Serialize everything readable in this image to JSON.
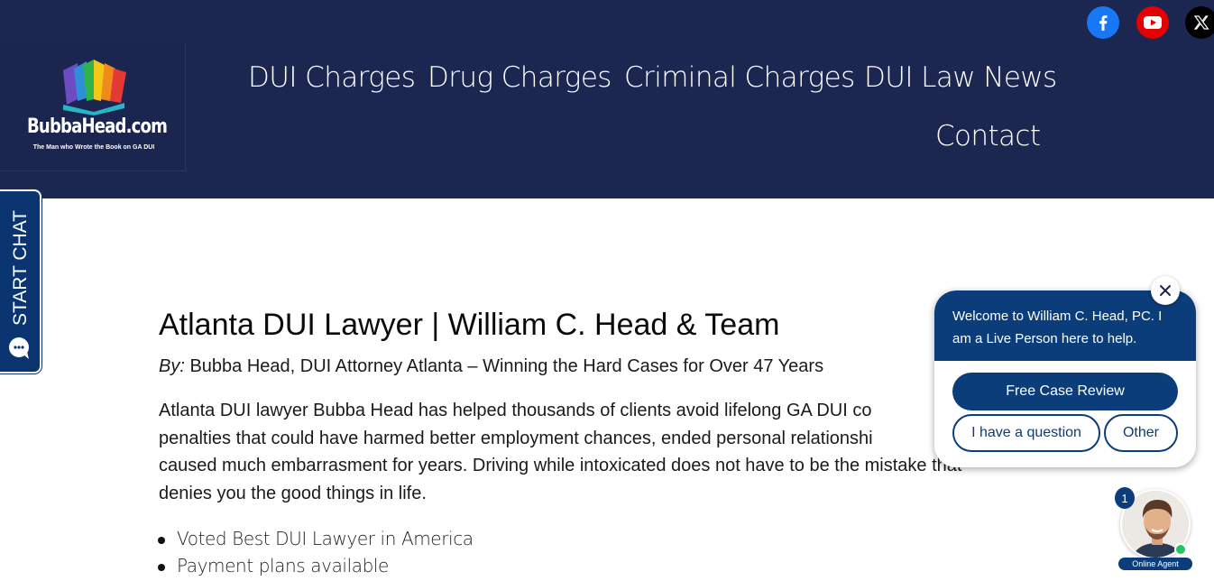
{
  "header": {
    "logo": {
      "name": "BubbaHead.com",
      "tagline": "The Man who Wrote the Book on GA DUI"
    },
    "nav": [
      {
        "label": "DUI Charges"
      },
      {
        "label": "Drug Charges"
      },
      {
        "label": "Criminal Charges"
      },
      {
        "label": "DUI Law News"
      },
      {
        "label": "Contact"
      }
    ],
    "social": [
      {
        "icon": "facebook-icon",
        "color": "#1877f2"
      },
      {
        "icon": "youtube-icon",
        "color": "#e60000"
      },
      {
        "icon": "x-icon",
        "color": "#000000"
      }
    ],
    "background": "#1b2750"
  },
  "side_chat": {
    "label": "START CHAT",
    "icon": "chat-bubble-icon",
    "color": "#0b3570"
  },
  "main": {
    "title": "Atlanta DUI Lawyer | William C. Head & Team",
    "byline_prefix": "By:",
    "byline_text": " Bubba Head, DUI Attorney Atlanta – Winning the Hard Cases for Over 47 Years",
    "paragraph_1": "Atlanta DUI lawyer Bubba Head has helped thousands of clients avoid lifelong GA DUI co",
    "paragraph_2": "penalties that could have harmed better employment chances, ended personal relationshi",
    "paragraph_3": "caused much embarrasment for years. Driving while intoxicated does not have to be the mistake that",
    "paragraph_4": "denies you the good things in life.",
    "bullets": [
      {
        "text": "Voted Best DUI Lawyer in America"
      },
      {
        "text": "Payment plans available"
      }
    ]
  },
  "chat_widget": {
    "welcome": "Welcome to William C. Head, PC. I am a Live Person here to help.",
    "primary_button": "Free Case Review",
    "question_button": "I have a question",
    "other_button": "Other",
    "close_icon": "close-icon",
    "accent": "#0a3d7a"
  },
  "agent": {
    "count": "1",
    "label": "Online Agent",
    "status_color": "#22c55e"
  }
}
